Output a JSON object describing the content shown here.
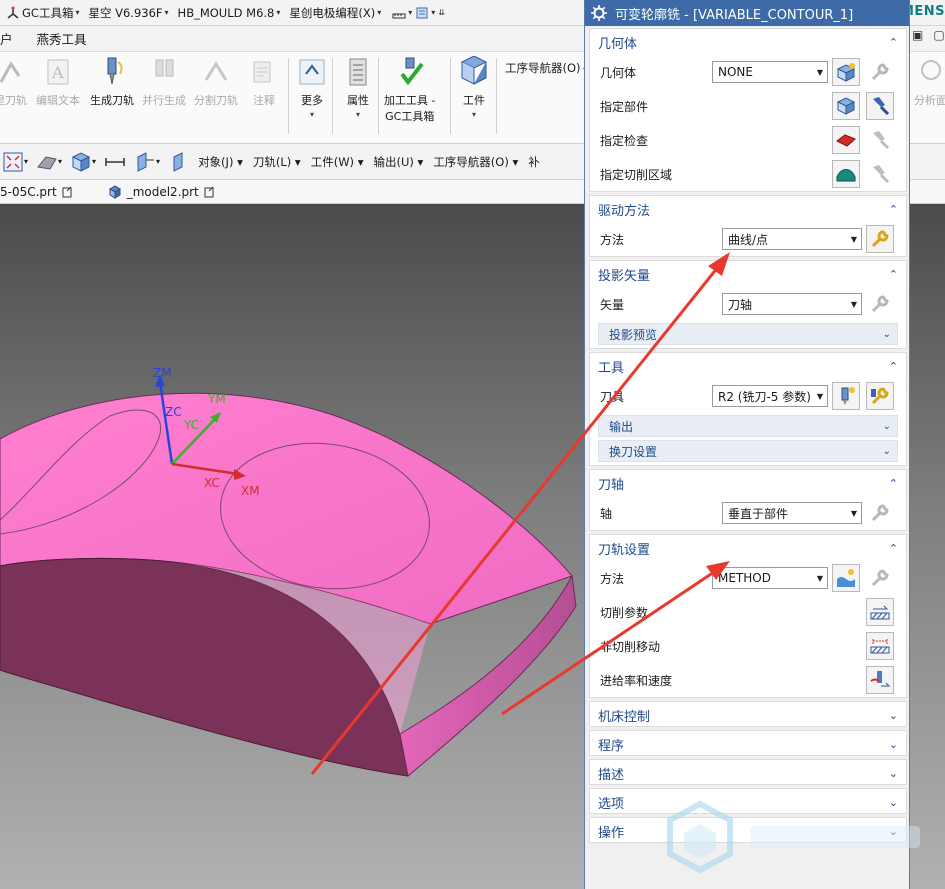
{
  "titlebar": {
    "gc_toolbox": "GC工具箱",
    "xingkong": "星空 V6.936F",
    "hb_mould": "HB_MOULD M6.8",
    "xingchuang": "星创电极编程(X)",
    "brand": "SIEMENS"
  },
  "menubar": {
    "tab_prefix": "户",
    "tab_yanxiu": "燕秀工具"
  },
  "ribbon": {
    "btn_create_toolpath_partial": "里刀轨",
    "btn_edit_text": "编辑文本",
    "btn_generate_toolpath": "生成刀轨",
    "btn_parallel_generate": "并行生成",
    "btn_split_toolpath": "分割刀轨",
    "btn_annotation": "注释",
    "btn_more": "更多",
    "btn_properties": "属性",
    "btn_machining_tool_line1": "加工工具 -",
    "btn_machining_tool_line2": "GC工具箱",
    "btn_workpiece": "工件",
    "op_navigator": "工序导航器(O)",
    "btn_analysis_partial": "分析面"
  },
  "toolbar2": {
    "object": "对象(J)",
    "toolpath": "刀轨(L)",
    "workpiece": "工件(W)",
    "output": "输出(U)",
    "op_navigator": "工序导航器(O)",
    "more_partial": "补"
  },
  "filetabs": {
    "file1": "5-05C.prt",
    "file2": "_model2.prt"
  },
  "viewport": {
    "axis_zm": "ZM",
    "axis_zc": "ZC",
    "axis_ym": "YM",
    "axis_yc": "YC",
    "axis_xc": "XC",
    "axis_xm": "XM",
    "part_color": "#ff7fcf",
    "annotation_color": "#e8392e"
  },
  "dialog": {
    "title": "可变轮廓铣 - [VARIABLE_CONTOUR_1]",
    "geometry": {
      "header": "几何体",
      "geometry_label": "几何体",
      "geometry_value": "NONE",
      "specify_part": "指定部件",
      "specify_check": "指定检查",
      "specify_cut_area": "指定切削区域"
    },
    "drive_method": {
      "header": "驱动方法",
      "method_label": "方法",
      "method_value": "曲线/点"
    },
    "projection_vector": {
      "header": "投影矢量",
      "vector_label": "矢量",
      "vector_value": "刀轴",
      "preview": "投影预览"
    },
    "tool": {
      "header": "工具",
      "tool_label": "刀具",
      "tool_value": "R2 (铣刀-5 参数)",
      "output": "输出",
      "tool_change": "换刀设置"
    },
    "tool_axis": {
      "header": "刀轴",
      "axis_label": "轴",
      "axis_value": "垂直于部件"
    },
    "path_settings": {
      "header": "刀轨设置",
      "method_label": "方法",
      "method_value": "METHOD",
      "cut_params": "切削参数",
      "non_cut_moves": "非切削移动",
      "feeds_speeds": "进给率和速度"
    },
    "collapsed": {
      "machine_control": "机床控制",
      "program": "程序",
      "description": "描述",
      "options": "选项",
      "actions": "操作"
    }
  }
}
